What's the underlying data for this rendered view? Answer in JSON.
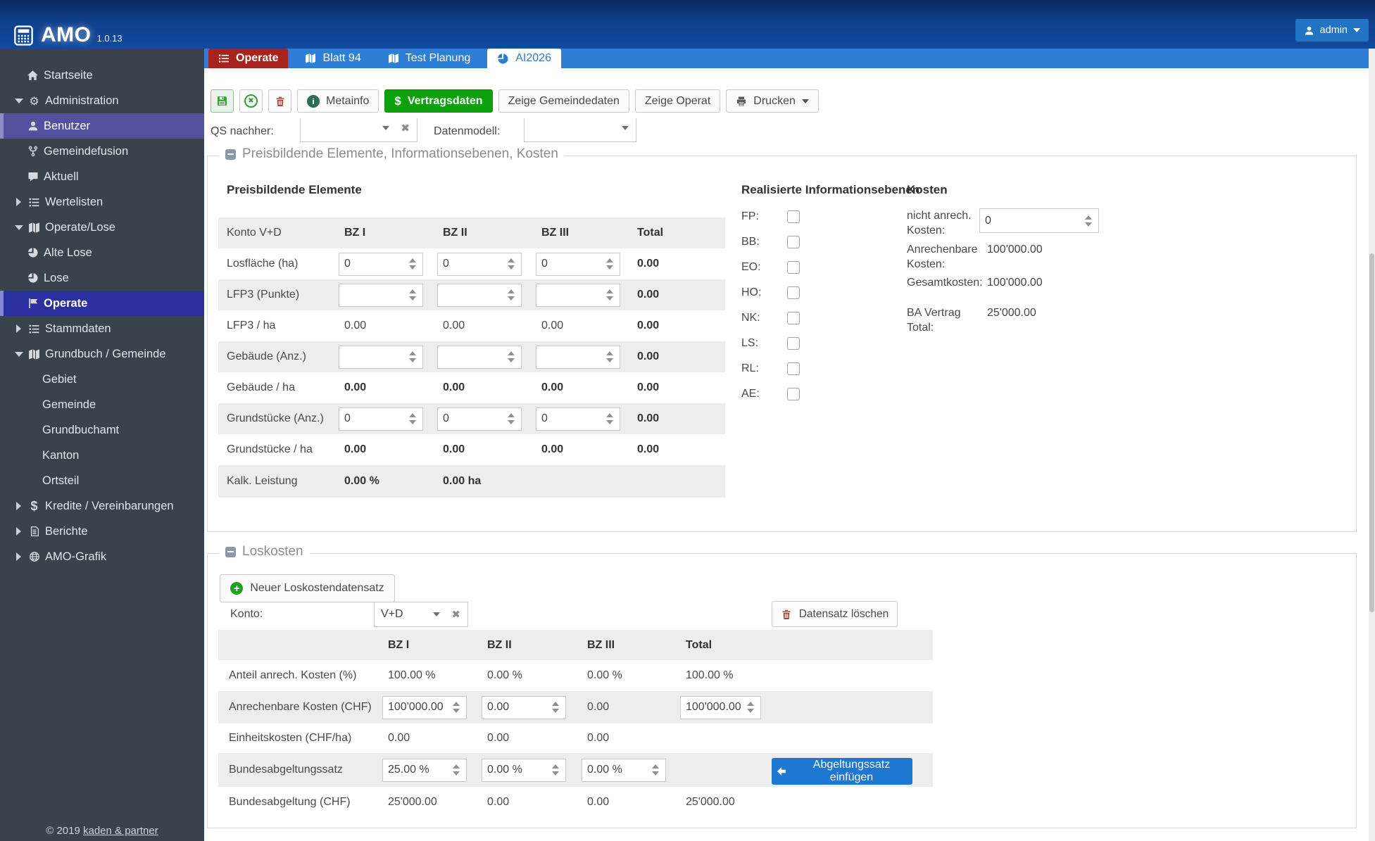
{
  "app": {
    "name": "AMO",
    "version": "1.0.13",
    "user": "admin"
  },
  "colors": {
    "header_navy": "#0f3f8d",
    "tab_bar_blue": "#2d7fd6",
    "active_tab_red": "#a8231e",
    "action_green": "#0ea10e",
    "action_blue": "#1e78d2",
    "sidebar_bg": "#3a424c",
    "highlight_purple": "#53509d",
    "highlight_indigo": "#2c2fa0",
    "danger_red": "#a94442"
  },
  "sidebar": {
    "items": [
      {
        "label": "Startseite"
      },
      {
        "label": "Administration"
      },
      {
        "label": "Benutzer"
      },
      {
        "label": "Gemeindefusion"
      },
      {
        "label": "Aktuell"
      },
      {
        "label": "Wertelisten"
      },
      {
        "label": "Operate/Lose"
      },
      {
        "label": "Alte Lose"
      },
      {
        "label": "Lose"
      },
      {
        "label": "Operate"
      },
      {
        "label": "Stammdaten"
      },
      {
        "label": "Grundbuch / Gemeinde"
      },
      {
        "label": "Gebiet"
      },
      {
        "label": "Gemeinde"
      },
      {
        "label": "Grundbuchamt"
      },
      {
        "label": "Kanton"
      },
      {
        "label": "Ortsteil"
      },
      {
        "label": "Kredite / Vereinbarungen"
      },
      {
        "label": "Berichte"
      },
      {
        "label": "AMO-Grafik"
      }
    ],
    "footer_copy": "© 2019 ",
    "footer_link": "kaden & partner"
  },
  "tabs": {
    "operate": "Operate",
    "blatt94": "Blatt 94",
    "test_planung": "Test Planung",
    "ai2026": "AI2026"
  },
  "toolbar": {
    "metainfo": "Metainfo",
    "vertragsdaten": "Vertragsdaten",
    "zeige_gemeindedaten": "Zeige Gemeindedaten",
    "zeige_operat": "Zeige Operat",
    "drucken": "Drucken",
    "dollar": "$"
  },
  "filters": {
    "qs_label": "QS nachher:",
    "qs_value": "",
    "dm_label": "Datenmodell:",
    "dm_value": ""
  },
  "fs1": {
    "legend": "Preisbildende Elemente, Informationsebenen, Kosten",
    "pe": {
      "heading": "Preisbildende Elemente",
      "h": {
        "c0": "Konto V+D",
        "c1": "BZ I",
        "c2": "BZ II",
        "c3": "BZ III",
        "c4": "Total"
      },
      "rows": [
        {
          "label": "Losfläche (ha)",
          "v1": "0",
          "v2": "0",
          "v3": "0",
          "total": "0.00"
        },
        {
          "label": "LFP3 (Punkte)",
          "v1": "",
          "v2": "",
          "v3": "",
          "total": "0.00"
        },
        {
          "label": "LFP3 / ha",
          "v1": "0.00",
          "v2": "0.00",
          "v3": "0.00",
          "total": "0.00"
        },
        {
          "label": "Gebäude (Anz.)",
          "v1": "",
          "v2": "",
          "v3": "",
          "total": "0.00"
        },
        {
          "label": "Gebäude / ha",
          "v1": "0.00",
          "v2": "0.00",
          "v3": "0.00",
          "total": "0.00"
        },
        {
          "label": "Grundstücke (Anz.)",
          "v1": "0",
          "v2": "0",
          "v3": "0",
          "total": "0.00"
        },
        {
          "label": "Grundstücke / ha",
          "v1": "0.00",
          "v2": "0.00",
          "v3": "0.00",
          "total": "0.00"
        },
        {
          "label": "Kalk. Leistung",
          "v1": "0.00 %",
          "v2": "0.00 ha",
          "v3": "",
          "total": ""
        }
      ]
    },
    "info": {
      "heading": "Realisierte Informationsebenen",
      "items": [
        "FP:",
        "BB:",
        "EO:",
        "HO:",
        "NK:",
        "LS:",
        "RL:",
        "AE:"
      ]
    },
    "kosten": {
      "heading": "Kosten",
      "rows": [
        {
          "label": "nicht anrech. Kosten:",
          "value": "0"
        },
        {
          "label": "Anrechenbare Kosten:",
          "value": "100'000.00"
        },
        {
          "label": "Gesamtkosten:",
          "value": "100'000.00"
        },
        {
          "label": "BA Vertrag Total:",
          "value": "25'000.00"
        }
      ]
    }
  },
  "fs2": {
    "legend": "Loskosten",
    "new_btn": "Neuer Loskostendatensatz",
    "konto_label": "Konto:",
    "konto_value": "V+D",
    "del_btn": "Datensatz löschen",
    "ins_btn": "Abgeltungssatz einfügen",
    "h": {
      "c1": "BZ I",
      "c2": "BZ II",
      "c3": "BZ III",
      "c4": "Total"
    },
    "rows": [
      {
        "label": "Anteil anrech. Kosten (%)",
        "v1": "100.00 %",
        "v2": "0.00 %",
        "v3": "0.00 %",
        "total": "100.00 %"
      },
      {
        "label": "Anrechenbare Kosten (CHF)",
        "v1": "100'000.00",
        "v2": "0.00",
        "v3": "0.00",
        "total": "100'000.00"
      },
      {
        "label": "Einheitskosten (CHF/ha)",
        "v1": "0.00",
        "v2": "0.00",
        "v3": "0.00",
        "total": ""
      },
      {
        "label": "Bundesabgeltungssatz",
        "v1": "25.00 %",
        "v2": "0.00 %",
        "v3": "0.00 %",
        "total": ""
      },
      {
        "label": "Bundesabgeltung (CHF)",
        "v1": "25'000.00",
        "v2": "0.00",
        "v3": "0.00",
        "total": "25'000.00"
      }
    ]
  }
}
